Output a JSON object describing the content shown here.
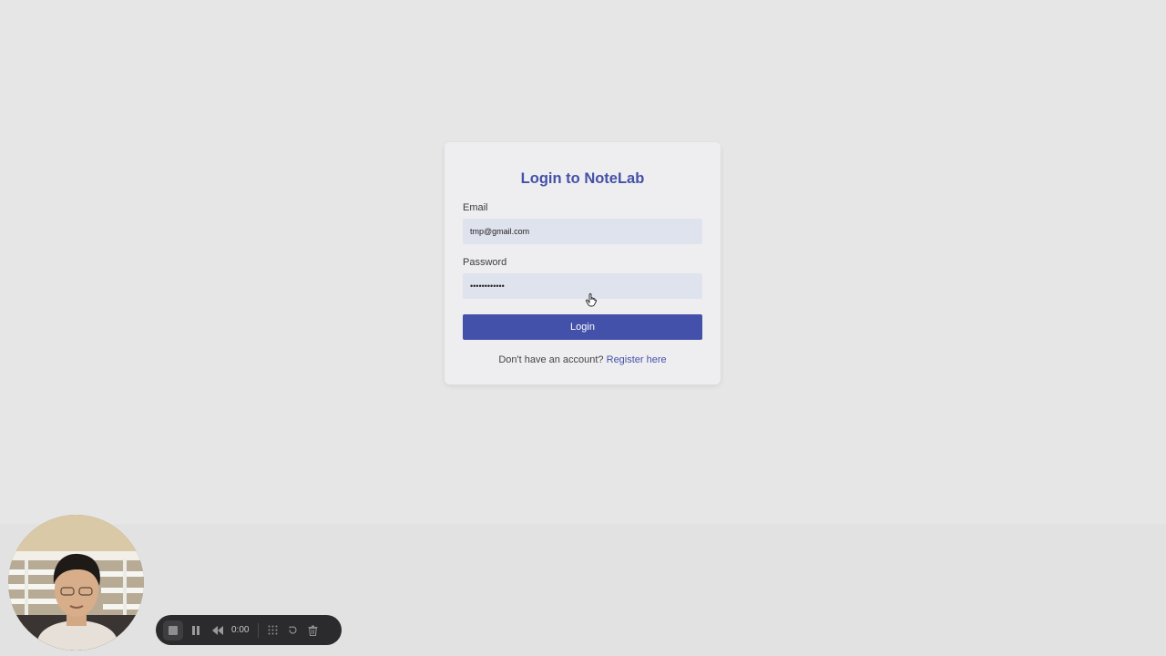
{
  "login": {
    "title": "Login to NoteLab",
    "email_label": "Email",
    "email_value": "tmp@gmail.com",
    "password_label": "Password",
    "password_value": "••••••••••••",
    "login_button": "Login",
    "register_prompt": "Don't have an account?",
    "register_link": "Register here"
  },
  "recorder": {
    "time": "0:00",
    "icons": [
      "stop-icon",
      "pause-icon",
      "rewind-icon",
      "grid-icon",
      "restart-icon",
      "trash-icon"
    ]
  },
  "colors": {
    "accent": "#4451ab",
    "background": "#e6e6e7",
    "card": "#eeeef0",
    "input": "#dfe3ee",
    "recorder_bar": "#2b2b2d"
  }
}
